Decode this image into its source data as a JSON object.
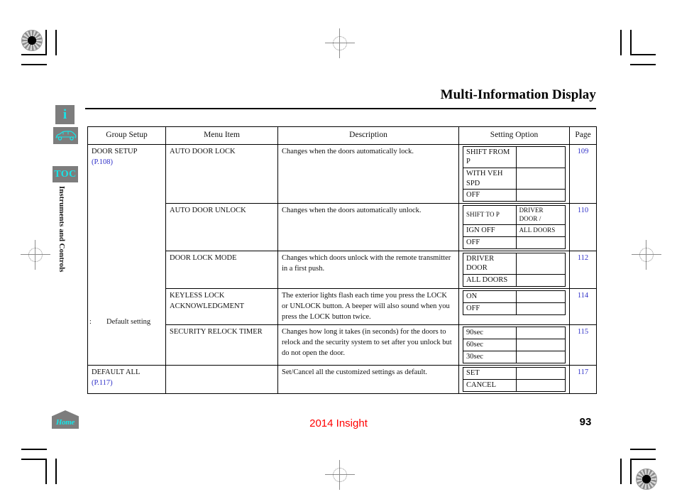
{
  "page": {
    "title": "Multi-Information Display",
    "section_label": "Instruments and Controls",
    "footer_model": "2014 Insight",
    "footer_page": "93",
    "footnote_symbol": ":",
    "footnote_text": "Default setting"
  },
  "rail": {
    "info_label": "i",
    "vehicle_label": "car-outline",
    "toc_label": "TOC",
    "home_label": "Home"
  },
  "table": {
    "headers": [
      "Group Setup",
      "Menu Item",
      "Description",
      "Setting Option",
      "Page"
    ],
    "rows": [
      {
        "group": "DOOR SETUP",
        "group_ref": "(P.108)",
        "menu": "AUTO DOOR LOCK",
        "description": "Changes when the doors automatically lock.",
        "options": [
          {
            "a": "SHIFT FROM P",
            "b": ""
          },
          {
            "a": "WITH VEH SPD",
            "b": ""
          },
          {
            "a": "OFF",
            "b": ""
          }
        ],
        "page": "109"
      },
      {
        "group": "",
        "group_ref": "",
        "menu": "AUTO DOOR UNLOCK",
        "description": "Changes when the doors automatically unlock.",
        "options": [
          {
            "a": "SHIFT TO P",
            "b": "DRIVER DOOR  /"
          },
          {
            "a": "IGN OFF",
            "b": "ALL DOORS"
          },
          {
            "a": "OFF",
            "b": ""
          }
        ],
        "page": "110"
      },
      {
        "group": "",
        "group_ref": "",
        "menu": "DOOR LOCK MODE",
        "description": "Changes which doors unlock with the remote transmitter in a first push.",
        "options": [
          {
            "a": "DRIVER DOOR",
            "b": ""
          },
          {
            "a": "ALL DOORS",
            "b": ""
          }
        ],
        "page": "112"
      },
      {
        "group": "",
        "group_ref": "",
        "menu": "KEYLESS LOCK ACKNOWLEDGMENT",
        "description": "The exterior lights flash each time you press the LOCK or UNLOCK button. A beeper will also sound when you press the LOCK button twice.",
        "options": [
          {
            "a": "ON",
            "b": ""
          },
          {
            "a": "OFF",
            "b": ""
          }
        ],
        "page": "114"
      },
      {
        "group": "",
        "group_ref": "",
        "menu": "SECURITY RELOCK TIMER",
        "description": "Changes how long it takes (in seconds) for the doors to relock and the security system to set after you unlock but do not open the door.",
        "options": [
          {
            "a": "90sec",
            "b": ""
          },
          {
            "a": "60sec",
            "b": ""
          },
          {
            "a": "30sec",
            "b": ""
          }
        ],
        "page": "115"
      },
      {
        "group": "DEFAULT ALL",
        "group_ref": "(P.117)",
        "menu": "",
        "description": "Set/Cancel all the customized settings as default.",
        "options": [
          {
            "a": "SET",
            "b": ""
          },
          {
            "a": "CANCEL",
            "b": ""
          }
        ],
        "page": "117"
      }
    ]
  },
  "colors": {
    "link_blue": "#2f30c8",
    "footer_red": "#ff0000",
    "icon_cyan": "#17e5e8",
    "icon_gray": "#7d7d7d"
  }
}
